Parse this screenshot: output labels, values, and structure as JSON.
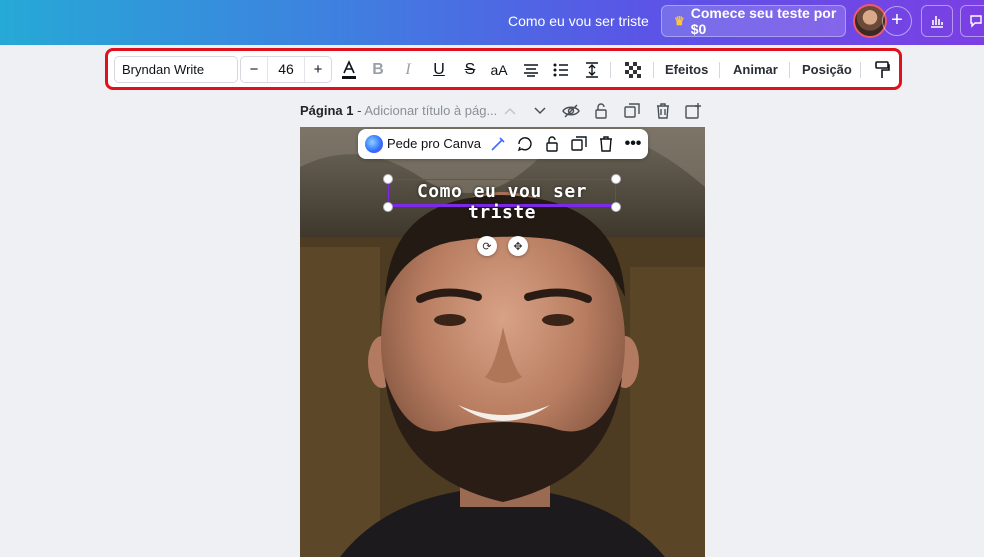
{
  "topbar": {
    "doc_title": "Como eu vou ser triste",
    "trial_button": "Comece seu teste por $0",
    "plus_label": "+"
  },
  "toolbar": {
    "font_name": "Bryndan Write",
    "font_size": "46",
    "minus_label": "−",
    "plus_label": "+",
    "case_label": "aA",
    "effects_label": "Efeitos",
    "animate_label": "Animar",
    "position_label": "Posição"
  },
  "page_header": {
    "page_name": "Página 1",
    "separator": " - ",
    "title_placeholder": "Adicionar título à pág..."
  },
  "context_bar": {
    "ai_label": "Pede pro Canva"
  },
  "canvas": {
    "selected_text": "Como eu vou ser triste"
  },
  "colors": {
    "highlight": "#e0101c",
    "selection": "#7d2ae8",
    "trial_crown": "#ffc53d"
  }
}
